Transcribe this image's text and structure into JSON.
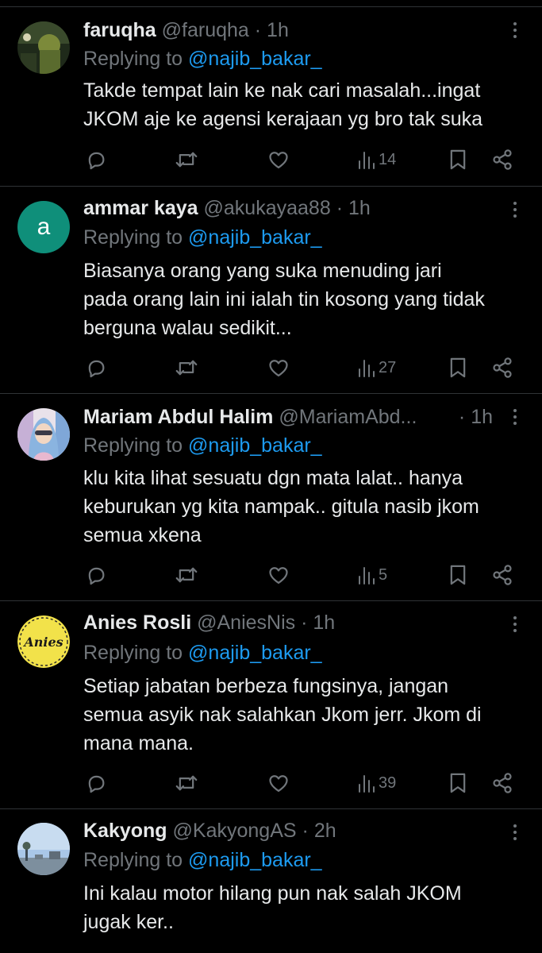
{
  "reply_prefix": "Replying to",
  "colors": {
    "background": "#000000",
    "text": "#e7e9ea",
    "muted": "#71767b",
    "link": "#1d9bf0",
    "divider": "#2f3336"
  },
  "icons": [
    "reply-icon",
    "retweet-icon",
    "like-icon",
    "views-icon",
    "bookmark-icon",
    "share-icon",
    "more-icon"
  ],
  "tweets": [
    {
      "name": "faruqha",
      "handle": "@faruqha",
      "sep": "·",
      "time": "1h",
      "reply_to": "@najib_bakar_",
      "lines": [
        "Takde tempat lain ke nak cari masalah...ingat",
        "JKOM aje ke agensi kerajaan yg bro tak suka"
      ],
      "views": "14"
    },
    {
      "name": "ammar kaya",
      "handle": "@akukayaa88",
      "sep": "·",
      "time": "1h",
      "avatar_letter": "a",
      "reply_to": "@najib_bakar_",
      "lines": [
        "Biasanya  orang yang suka menuding jari",
        "pada orang lain ini ialah tin kosong yang tidak",
        "berguna walau sedikit..."
      ],
      "views": "27"
    },
    {
      "name": "Mariam Abdul Halim",
      "handle": "@MariamAbd...",
      "sep": "·",
      "time": "1h",
      "reply_to": "@najib_bakar_",
      "lines": [
        "klu kita lihat sesuatu dgn mata lalat.. hanya",
        "keburukan  yg kita nampak.. gitula nasib jkom",
        "semua xkena"
      ],
      "views": "5"
    },
    {
      "name": "Anies Rosli",
      "handle": "@AniesNis",
      "sep": "·",
      "time": "1h",
      "avatar_text": "Anies",
      "reply_to": "@najib_bakar_",
      "lines": [
        "Setiap jabatan berbeza fungsinya, jangan",
        "semua asyik nak salahkan Jkom jerr. Jkom di",
        "mana mana."
      ],
      "views": "39"
    },
    {
      "name": "Kakyong",
      "handle": "@KakyongAS",
      "sep": "·",
      "time": "2h",
      "reply_to": "@najib_bakar_",
      "lines": [
        "Ini kalau motor hilang pun nak salah JKOM",
        "jugak ker.."
      ]
    }
  ]
}
